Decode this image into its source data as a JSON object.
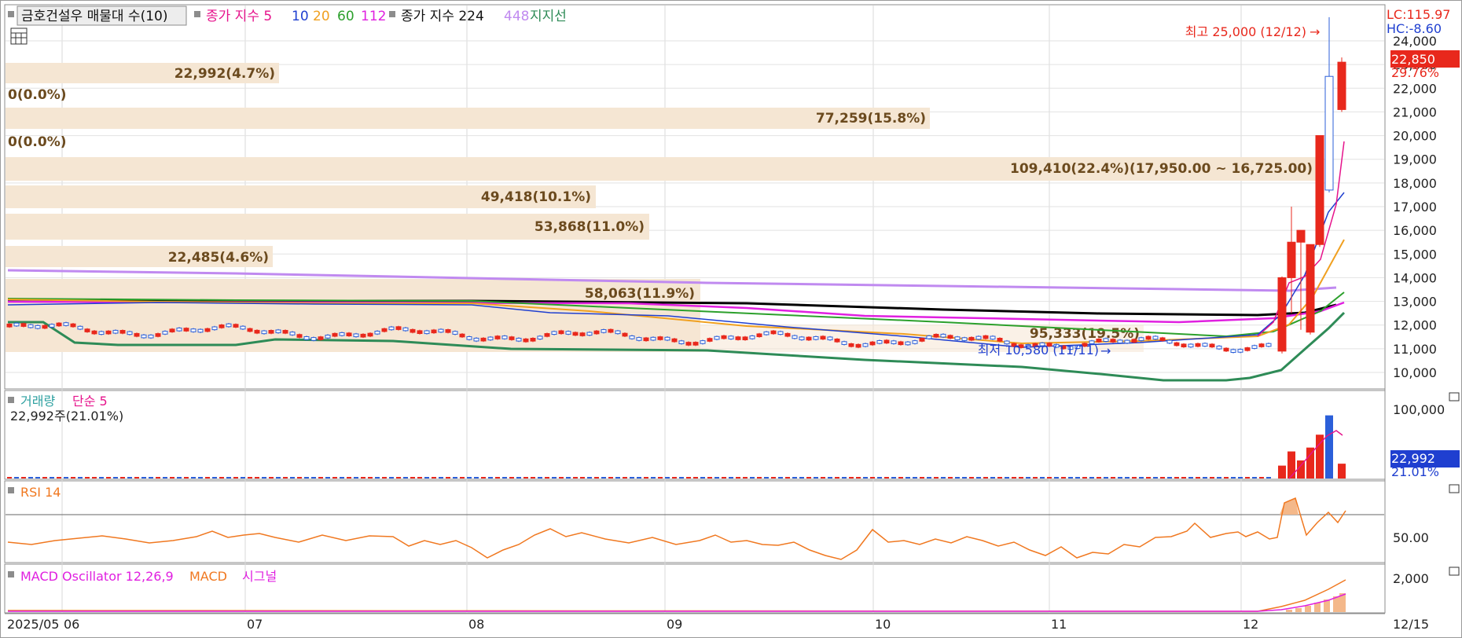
{
  "colors": {
    "up": "#e8281c",
    "down": "#2b5fd9",
    "ma5": "#e6148c",
    "ma10": "#1f3fd0",
    "ma20": "#f0a020",
    "ma60": "#2ca02c",
    "ma112": "#e020e0",
    "ma224": "#000000",
    "ma448": "#c08af0",
    "support": "#2e8b57",
    "profile": "#f5e6d3",
    "rsi": "#f07820",
    "macd": "#f07820",
    "signal": "#e020e0"
  },
  "legend": {
    "title": "금호건설우 매물대 수(10)",
    "ma_prefix": "종가 지수 5",
    "ma10": "10",
    "ma20": "20",
    "ma60": "60",
    "ma112": "112",
    "ma224": "종가 지수 224",
    "ma448": "448",
    "support": "지지선"
  },
  "price_panel": {
    "lc": "LC:115.97",
    "hc": "HC:-8.60",
    "current_price": "22,850",
    "change_pct": "29.76%",
    "high_label": "최고 25,000 (12/12)",
    "low_label": "최저 10,580 (11/11)",
    "overlap_label": "95,333(19.5%)",
    "y_ticks": [
      "24,000",
      "23,000",
      "22,000",
      "21,000",
      "20,000",
      "19,000",
      "18,000",
      "17,000",
      "16,000",
      "15,000",
      "14,000",
      "13,000",
      "12,000",
      "11,000",
      "10,000"
    ]
  },
  "volume_profile": [
    {
      "label": "22,992(4.7%)"
    },
    {
      "label": "0(0.0%)"
    },
    {
      "label": "77,259(15.8%)"
    },
    {
      "label": "0(0.0%)"
    },
    {
      "label": "109,410(22.4%)(17,950.00 ~ 16,725.00)"
    },
    {
      "label": "49,418(10.1%)"
    },
    {
      "label": "53,868(11.0%)"
    },
    {
      "label": "22,485(4.6%)"
    },
    {
      "label": "58,063(11.9%)"
    }
  ],
  "volume_panel": {
    "title": "거래량",
    "ma_label": "단순 5",
    "current": "22,992주(21.01%)",
    "y_tick": "100,000",
    "value_box": "22,992",
    "value_pct": "21.01%"
  },
  "rsi_panel": {
    "title": "RSI 14",
    "y_tick": "50.00"
  },
  "macd_panel": {
    "title": "MACD Oscillator 12,26,9",
    "macd_label": "MACD",
    "signal_label": "시그널",
    "y_tick": "2,000"
  },
  "x_axis": {
    "ticks": [
      "2025/05",
      "06",
      "07",
      "08",
      "09",
      "10",
      "11",
      "12"
    ],
    "right_label": "12/15"
  },
  "chart_data": {
    "type": "candlestick",
    "title": "금호건설우 매물대 수(10)",
    "ylim": [
      9800,
      25200
    ],
    "x_range": [
      "2025/05",
      "12/15"
    ],
    "recent_candles": [
      {
        "open": 10900,
        "high": 14050,
        "low": 10800,
        "close": 14000
      },
      {
        "open": 14000,
        "high": 17000,
        "low": 12500,
        "close": 15500
      },
      {
        "open": 15500,
        "high": 16000,
        "low": 11800,
        "close": 16000
      },
      {
        "open": 11700,
        "high": 15400,
        "low": 11600,
        "close": 15400
      },
      {
        "open": 15400,
        "high": 20000,
        "low": 15300,
        "close": 20000
      },
      {
        "open": 22500,
        "high": 25000,
        "low": 17600,
        "close": 17700
      },
      {
        "open": 21100,
        "high": 23300,
        "low": 21000,
        "close": 23100
      }
    ],
    "high": {
      "value": 25000,
      "date": "12/12"
    },
    "low": {
      "value": 10580,
      "date": "11/11"
    },
    "last_close": 22850,
    "change_pct": 29.76,
    "volume_profile_bins": [
      {
        "volume": 22992,
        "pct": 4.7
      },
      {
        "volume": 0,
        "pct": 0.0
      },
      {
        "volume": 77259,
        "pct": 15.8
      },
      {
        "volume": 0,
        "pct": 0.0
      },
      {
        "volume": 109410,
        "pct": 22.4,
        "range": [
          16725,
          17950
        ]
      },
      {
        "volume": 49418,
        "pct": 10.1
      },
      {
        "volume": 53868,
        "pct": 11.0
      },
      {
        "volume": 22485,
        "pct": 4.6
      },
      {
        "volume": 58063,
        "pct": 11.9
      },
      {
        "volume": 95333,
        "pct": 19.5
      }
    ],
    "volume_last": 22992,
    "rsi_ref": 50,
    "macd_ref": 2000
  }
}
